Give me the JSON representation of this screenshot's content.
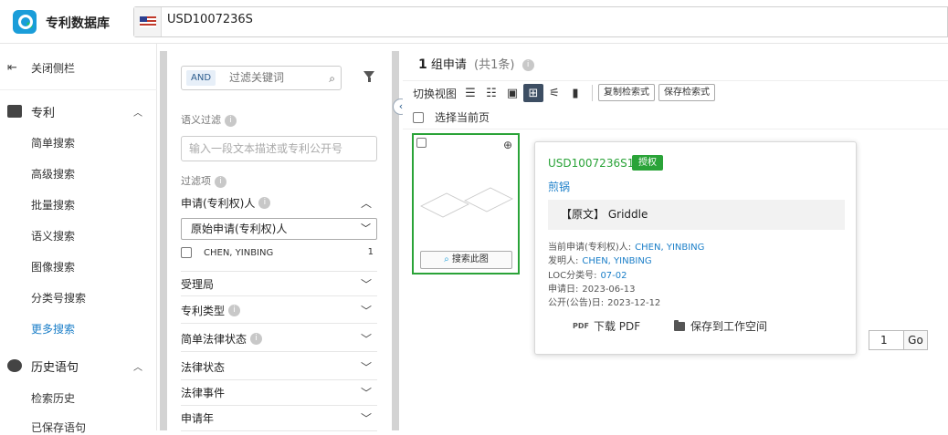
{
  "app": {
    "title": "专利数据库"
  },
  "search": {
    "value": "USD1007236S"
  },
  "sidebar": {
    "close": "关闭侧栏",
    "groups": [
      {
        "label": "专利",
        "items": [
          "简单搜索",
          "高级搜索",
          "批量搜索",
          "语义搜索",
          "图像搜索",
          "分类号搜索",
          "更多搜索"
        ],
        "active": "更多搜索"
      },
      {
        "label": "历史语句",
        "items": [
          "检索历史",
          "已保存语句"
        ]
      }
    ]
  },
  "filter": {
    "and_label": "AND",
    "keyword_placeholder": "过滤关键词",
    "semantic_label": "语义过滤",
    "semantic_placeholder": "输入一段文本描述或专利公开号",
    "items_label": "过滤项",
    "applicant_section": "申请(专利权)人",
    "applicant_select": "原始申请(专利权)人",
    "applicant_option": {
      "name": "CHEN, YINBING",
      "count": "1"
    },
    "sections": [
      "受理局",
      "专利类型",
      "简单法律状态",
      "法律状态",
      "法律事件",
      "申请年"
    ]
  },
  "results": {
    "count": "1",
    "unit": "组申请",
    "total": "(共1条)",
    "view_label": "切换视图",
    "copy_query": "复制检索式",
    "save_query": "保存检索式",
    "select_page": "选择当前页",
    "card_search": "搜索此图"
  },
  "popup": {
    "pn": "USD1007236S1",
    "status": "授权",
    "title_cn": "煎锅",
    "orig_tag": "【原文】",
    "orig_title": "Griddle",
    "fields": [
      {
        "k": "当前申请(专利权)人:",
        "v": "CHEN, YINBING",
        "link": true
      },
      {
        "k": "发明人:",
        "v": "CHEN, YINBING",
        "link": true
      },
      {
        "k": "LOC分类号:",
        "v": "07-02",
        "link": true
      },
      {
        "k": "申请日:",
        "v": "2023-06-13",
        "link": false
      },
      {
        "k": "公开(公告)日:",
        "v": "2023-12-12",
        "link": false
      }
    ],
    "download_pdf": "下载 PDF",
    "save_workspace": "保存到工作空间"
  },
  "pager": {
    "page": "1",
    "go": "Go"
  },
  "colors": {
    "accent": "#1a7ec8",
    "granted": "#2aa338",
    "nav_active": "#3d4e63"
  }
}
